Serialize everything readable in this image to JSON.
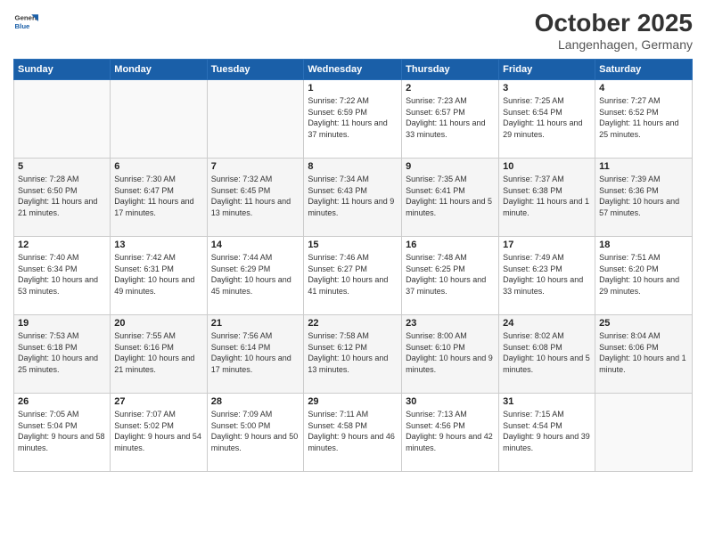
{
  "header": {
    "logo_line1": "General",
    "logo_line2": "Blue",
    "month": "October 2025",
    "location": "Langenhagen, Germany"
  },
  "weekdays": [
    "Sunday",
    "Monday",
    "Tuesday",
    "Wednesday",
    "Thursday",
    "Friday",
    "Saturday"
  ],
  "weeks": [
    [
      {
        "day": "",
        "sunrise": "",
        "sunset": "",
        "daylight": ""
      },
      {
        "day": "",
        "sunrise": "",
        "sunset": "",
        "daylight": ""
      },
      {
        "day": "",
        "sunrise": "",
        "sunset": "",
        "daylight": ""
      },
      {
        "day": "1",
        "sunrise": "Sunrise: 7:22 AM",
        "sunset": "Sunset: 6:59 PM",
        "daylight": "Daylight: 11 hours and 37 minutes."
      },
      {
        "day": "2",
        "sunrise": "Sunrise: 7:23 AM",
        "sunset": "Sunset: 6:57 PM",
        "daylight": "Daylight: 11 hours and 33 minutes."
      },
      {
        "day": "3",
        "sunrise": "Sunrise: 7:25 AM",
        "sunset": "Sunset: 6:54 PM",
        "daylight": "Daylight: 11 hours and 29 minutes."
      },
      {
        "day": "4",
        "sunrise": "Sunrise: 7:27 AM",
        "sunset": "Sunset: 6:52 PM",
        "daylight": "Daylight: 11 hours and 25 minutes."
      }
    ],
    [
      {
        "day": "5",
        "sunrise": "Sunrise: 7:28 AM",
        "sunset": "Sunset: 6:50 PM",
        "daylight": "Daylight: 11 hours and 21 minutes."
      },
      {
        "day": "6",
        "sunrise": "Sunrise: 7:30 AM",
        "sunset": "Sunset: 6:47 PM",
        "daylight": "Daylight: 11 hours and 17 minutes."
      },
      {
        "day": "7",
        "sunrise": "Sunrise: 7:32 AM",
        "sunset": "Sunset: 6:45 PM",
        "daylight": "Daylight: 11 hours and 13 minutes."
      },
      {
        "day": "8",
        "sunrise": "Sunrise: 7:34 AM",
        "sunset": "Sunset: 6:43 PM",
        "daylight": "Daylight: 11 hours and 9 minutes."
      },
      {
        "day": "9",
        "sunrise": "Sunrise: 7:35 AM",
        "sunset": "Sunset: 6:41 PM",
        "daylight": "Daylight: 11 hours and 5 minutes."
      },
      {
        "day": "10",
        "sunrise": "Sunrise: 7:37 AM",
        "sunset": "Sunset: 6:38 PM",
        "daylight": "Daylight: 11 hours and 1 minute."
      },
      {
        "day": "11",
        "sunrise": "Sunrise: 7:39 AM",
        "sunset": "Sunset: 6:36 PM",
        "daylight": "Daylight: 10 hours and 57 minutes."
      }
    ],
    [
      {
        "day": "12",
        "sunrise": "Sunrise: 7:40 AM",
        "sunset": "Sunset: 6:34 PM",
        "daylight": "Daylight: 10 hours and 53 minutes."
      },
      {
        "day": "13",
        "sunrise": "Sunrise: 7:42 AM",
        "sunset": "Sunset: 6:31 PM",
        "daylight": "Daylight: 10 hours and 49 minutes."
      },
      {
        "day": "14",
        "sunrise": "Sunrise: 7:44 AM",
        "sunset": "Sunset: 6:29 PM",
        "daylight": "Daylight: 10 hours and 45 minutes."
      },
      {
        "day": "15",
        "sunrise": "Sunrise: 7:46 AM",
        "sunset": "Sunset: 6:27 PM",
        "daylight": "Daylight: 10 hours and 41 minutes."
      },
      {
        "day": "16",
        "sunrise": "Sunrise: 7:48 AM",
        "sunset": "Sunset: 6:25 PM",
        "daylight": "Daylight: 10 hours and 37 minutes."
      },
      {
        "day": "17",
        "sunrise": "Sunrise: 7:49 AM",
        "sunset": "Sunset: 6:23 PM",
        "daylight": "Daylight: 10 hours and 33 minutes."
      },
      {
        "day": "18",
        "sunrise": "Sunrise: 7:51 AM",
        "sunset": "Sunset: 6:20 PM",
        "daylight": "Daylight: 10 hours and 29 minutes."
      }
    ],
    [
      {
        "day": "19",
        "sunrise": "Sunrise: 7:53 AM",
        "sunset": "Sunset: 6:18 PM",
        "daylight": "Daylight: 10 hours and 25 minutes."
      },
      {
        "day": "20",
        "sunrise": "Sunrise: 7:55 AM",
        "sunset": "Sunset: 6:16 PM",
        "daylight": "Daylight: 10 hours and 21 minutes."
      },
      {
        "day": "21",
        "sunrise": "Sunrise: 7:56 AM",
        "sunset": "Sunset: 6:14 PM",
        "daylight": "Daylight: 10 hours and 17 minutes."
      },
      {
        "day": "22",
        "sunrise": "Sunrise: 7:58 AM",
        "sunset": "Sunset: 6:12 PM",
        "daylight": "Daylight: 10 hours and 13 minutes."
      },
      {
        "day": "23",
        "sunrise": "Sunrise: 8:00 AM",
        "sunset": "Sunset: 6:10 PM",
        "daylight": "Daylight: 10 hours and 9 minutes."
      },
      {
        "day": "24",
        "sunrise": "Sunrise: 8:02 AM",
        "sunset": "Sunset: 6:08 PM",
        "daylight": "Daylight: 10 hours and 5 minutes."
      },
      {
        "day": "25",
        "sunrise": "Sunrise: 8:04 AM",
        "sunset": "Sunset: 6:06 PM",
        "daylight": "Daylight: 10 hours and 1 minute."
      }
    ],
    [
      {
        "day": "26",
        "sunrise": "Sunrise: 7:05 AM",
        "sunset": "Sunset: 5:04 PM",
        "daylight": "Daylight: 9 hours and 58 minutes."
      },
      {
        "day": "27",
        "sunrise": "Sunrise: 7:07 AM",
        "sunset": "Sunset: 5:02 PM",
        "daylight": "Daylight: 9 hours and 54 minutes."
      },
      {
        "day": "28",
        "sunrise": "Sunrise: 7:09 AM",
        "sunset": "Sunset: 5:00 PM",
        "daylight": "Daylight: 9 hours and 50 minutes."
      },
      {
        "day": "29",
        "sunrise": "Sunrise: 7:11 AM",
        "sunset": "Sunset: 4:58 PM",
        "daylight": "Daylight: 9 hours and 46 minutes."
      },
      {
        "day": "30",
        "sunrise": "Sunrise: 7:13 AM",
        "sunset": "Sunset: 4:56 PM",
        "daylight": "Daylight: 9 hours and 42 minutes."
      },
      {
        "day": "31",
        "sunrise": "Sunrise: 7:15 AM",
        "sunset": "Sunset: 4:54 PM",
        "daylight": "Daylight: 9 hours and 39 minutes."
      },
      {
        "day": "",
        "sunrise": "",
        "sunset": "",
        "daylight": ""
      }
    ]
  ]
}
